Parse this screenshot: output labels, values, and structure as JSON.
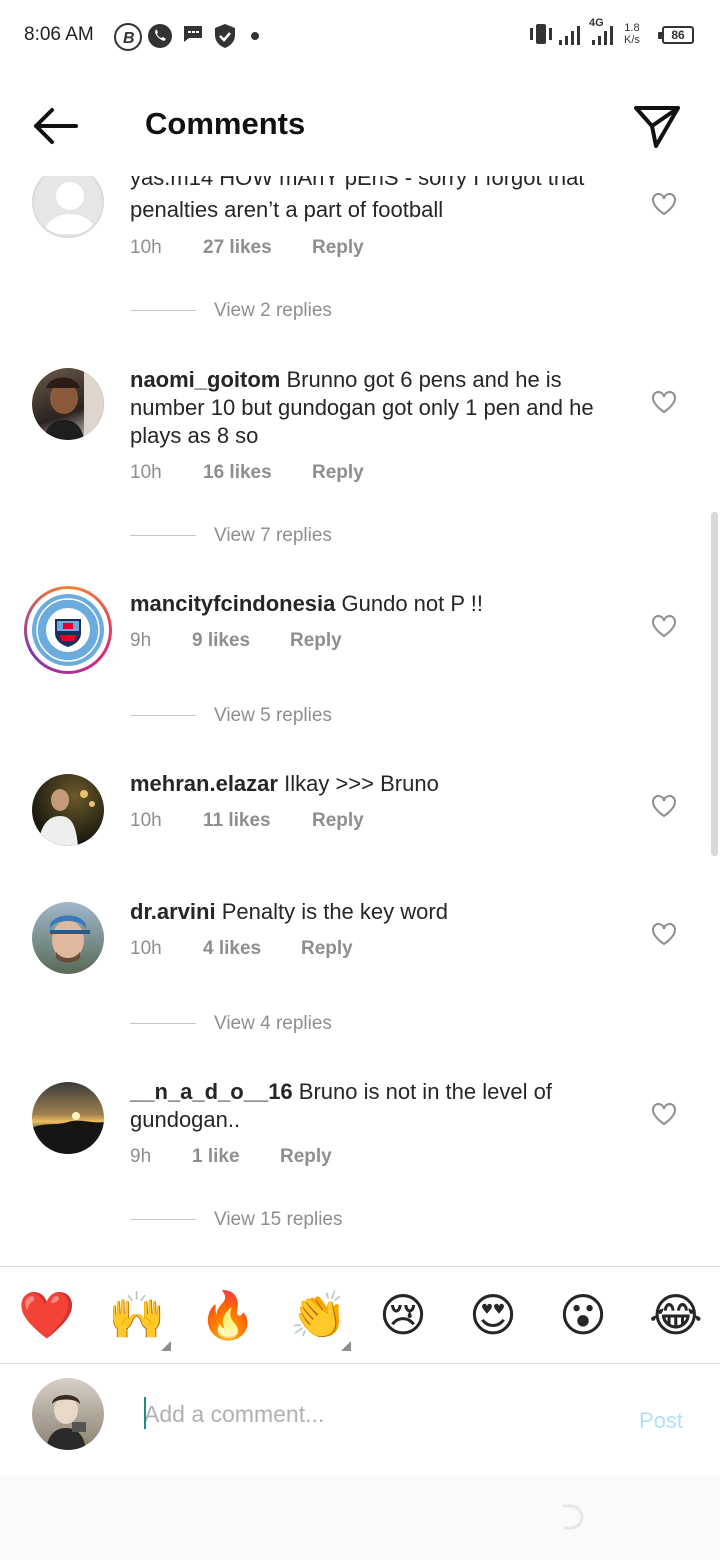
{
  "status_bar": {
    "time": "8:06 AM",
    "network": "4G",
    "speed_value": "1.8",
    "speed_unit": "K/s",
    "battery": "86"
  },
  "header": {
    "title": "Comments",
    "back_icon": "arrow-left-icon",
    "send_icon": "paper-plane-icon"
  },
  "comments": [
    {
      "username": "yas.m14",
      "text": "HOW mAnY pEnS - sorry I forgot that penalties aren’t a part of football",
      "text_line1_partial": "yas.m14 HOW mAnY pEnS - sorry I forgot that",
      "text_line2": "penalties aren’t a part of football",
      "time": "10h",
      "likes": "27 likes",
      "reply": "Reply",
      "view_replies": "View 2 replies"
    },
    {
      "username": "naomi_goitom",
      "text": "Brunno got 6 pens and he is number 10 but gundogan got only 1 pen and he plays as 8 so",
      "time": "10h",
      "likes": "16 likes",
      "reply": "Reply",
      "view_replies": "View 7 replies"
    },
    {
      "username": "mancityfcindonesia",
      "text": "Gundo not P !!",
      "time": "9h",
      "likes": "9 likes",
      "reply": "Reply",
      "view_replies": "View 5 replies"
    },
    {
      "username": "mehran.elazar",
      "text": "Ilkay >>> Bruno",
      "time": "10h",
      "likes": "11 likes",
      "reply": "Reply",
      "view_replies": ""
    },
    {
      "username": "dr.arvini",
      "text": "Penalty is the key word",
      "time": "10h",
      "likes": "4 likes",
      "reply": "Reply",
      "view_replies": "View 4 replies"
    },
    {
      "username": "__n_a_d_o__16",
      "text": "Bruno is not in the level of gundogan..",
      "time": "9h",
      "likes": "1 like",
      "reply": "Reply",
      "view_replies": "View 15 replies"
    }
  ],
  "emoji_bar": [
    "❤️",
    "🙌",
    "🔥",
    "👏",
    "😢",
    "😍",
    "😮",
    "😂"
  ],
  "input": {
    "placeholder": "Add a comment...",
    "post_label": "Post"
  },
  "colors": {
    "text": "#262626",
    "secondary": "#8e8e8e",
    "post_disabled": "#b2dffc",
    "story_ring_start": "#f58529",
    "story_ring_end": "#dd2a7b"
  }
}
